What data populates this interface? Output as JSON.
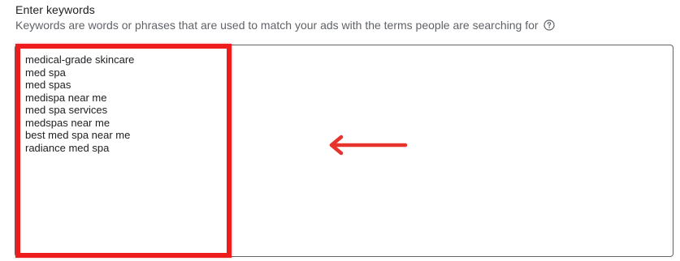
{
  "section": {
    "title": "Enter keywords",
    "helper": "Keywords are words or phrases that are used to match your ads with the terms people are searching for"
  },
  "keywords": [
    "medical-grade skincare",
    "med spa",
    "med spas",
    "medispa near me",
    "med spa services",
    "medspas near me",
    "best med spa near me",
    "radiance med spa"
  ],
  "icons": {
    "help": "help-circle-icon",
    "arrow": "left-arrow-annotation"
  },
  "colors": {
    "annotation": "#ee1c1c",
    "arrow": "#e8322c",
    "border": "#5f6368"
  }
}
